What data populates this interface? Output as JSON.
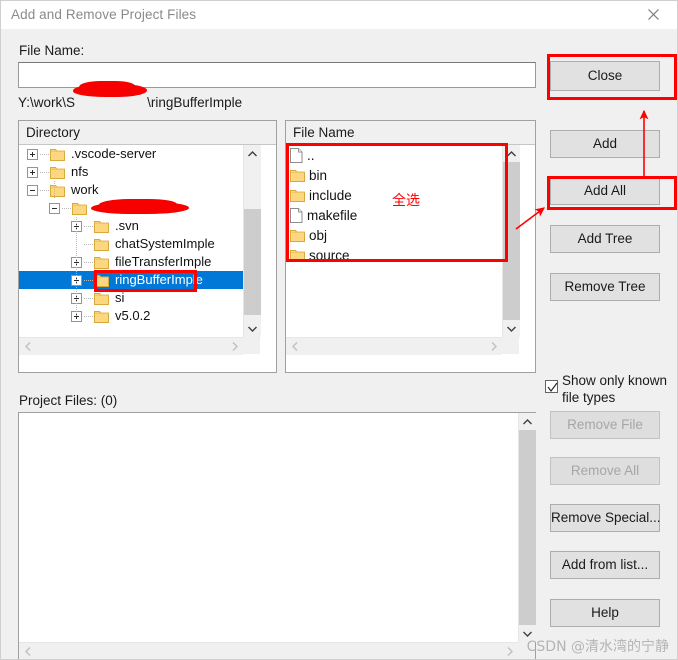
{
  "window": {
    "title": "Add and Remove Project Files",
    "close_icon": "close-icon"
  },
  "form": {
    "file_name_label": "File Name:",
    "file_name_value": "",
    "file_name_placeholder": "",
    "path_prefix": "Y:\\work\\S",
    "path_redacted": "XXXXXXXX",
    "path_suffix": "\\ringBufferImple"
  },
  "directory_panel": {
    "header": "Directory",
    "tree": [
      {
        "label": ".vscode-server",
        "depth": 0,
        "twisty": "plus",
        "icon": "folder-icon",
        "selected": false
      },
      {
        "label": "nfs",
        "depth": 0,
        "twisty": "plus",
        "icon": "folder-icon",
        "selected": false
      },
      {
        "label": "work",
        "depth": 0,
        "twisty": "minus",
        "icon": "folder-icon",
        "selected": false
      },
      {
        "label": "",
        "depth": 1,
        "twisty": "minus",
        "icon": "folder-icon",
        "selected": false,
        "redacted": true
      },
      {
        "label": ".svn",
        "depth": 2,
        "twisty": "plus",
        "icon": "folder-icon",
        "selected": false
      },
      {
        "label": "chatSystemImple",
        "depth": 2,
        "twisty": "none",
        "icon": "folder-icon",
        "selected": false
      },
      {
        "label": "fileTransferImple",
        "depth": 2,
        "twisty": "plus",
        "icon": "folder-icon",
        "selected": false
      },
      {
        "label": "ringBufferImple",
        "depth": 2,
        "twisty": "plus",
        "icon": "folder-icon",
        "selected": true
      },
      {
        "label": "si",
        "depth": 2,
        "twisty": "plus",
        "icon": "folder-icon",
        "selected": false
      },
      {
        "label": "v5.0.2",
        "depth": 2,
        "twisty": "plus",
        "icon": "folder-icon",
        "selected": false
      }
    ]
  },
  "file_panel": {
    "header": "File Name",
    "files": [
      {
        "label": "..",
        "icon": "file-icon"
      },
      {
        "label": "bin",
        "icon": "folder-icon"
      },
      {
        "label": "include",
        "icon": "folder-icon"
      },
      {
        "label": "makefile",
        "icon": "file-icon"
      },
      {
        "label": "obj",
        "icon": "folder-icon"
      },
      {
        "label": "source",
        "icon": "folder-icon"
      }
    ]
  },
  "project_files": {
    "label": "Project Files: (0)",
    "items": []
  },
  "buttons": {
    "close": "Close",
    "add": "Add",
    "add_all": "Add All",
    "add_tree": "Add Tree",
    "remove_tree": "Remove Tree",
    "remove_file": "Remove File",
    "remove_all": "Remove All",
    "remove_special": "Remove Special...",
    "add_from_list": "Add from list...",
    "help": "Help"
  },
  "checkbox": {
    "label": "Show only known file types",
    "checked": true
  },
  "annotations": {
    "note_text": "全选",
    "highlight_color": "#ff0000"
  },
  "watermark": {
    "text": "CSDN @清水湾的宁静"
  },
  "colors": {
    "dialog_bg": "#f0f0f0",
    "selection_blue": "#0078d7",
    "annotation_red": "#ff0000",
    "folder_yellow": "#fcd77f",
    "button_face": "#e1e1e1"
  }
}
